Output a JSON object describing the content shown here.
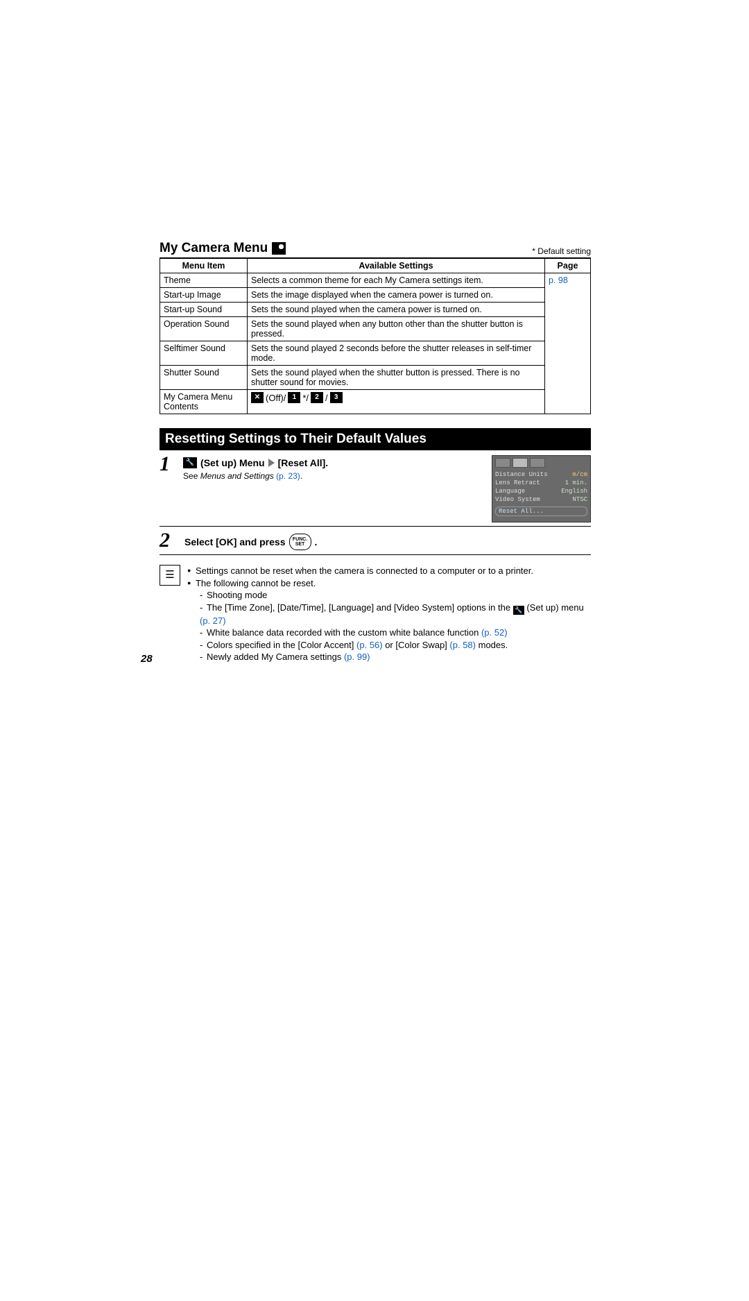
{
  "page_number": "28",
  "title": "My Camera Menu",
  "default_note": "* Default setting",
  "table": {
    "headers": [
      "Menu Item",
      "Available Settings",
      "Page"
    ],
    "page_ref": "p. 98",
    "rows": [
      {
        "item": "Theme",
        "desc": "Selects a common theme for each My Camera settings item."
      },
      {
        "item": "Start-up Image",
        "desc": "Sets the image displayed when the camera power is turned on."
      },
      {
        "item": "Start-up Sound",
        "desc": "Sets the sound played when the camera power is turned on."
      },
      {
        "item": "Operation Sound",
        "desc": "Sets the sound played when any button other than the shutter button is pressed."
      },
      {
        "item": "Selftimer Sound",
        "desc": "Sets the sound played 2 seconds before the shutter releases in self-timer mode."
      },
      {
        "item": "Shutter Sound",
        "desc": "Sets the sound played when the shutter button is pressed. There is no shutter sound for movies."
      },
      {
        "item": "My Camera Menu Contents",
        "desc_icons": {
          "off": "(Off)/",
          "sep": "/",
          "star": "*/"
        }
      }
    ]
  },
  "banner": "Resetting Settings to Their Default Values",
  "steps": {
    "s1": {
      "num": "1",
      "label_pre": "(Set up) Menu",
      "label_post": "[Reset All].",
      "see_text": "See ",
      "see_em": "Menus and Settings ",
      "see_link": "(p. 23)",
      "lcd": {
        "rows": [
          {
            "l": "Distance Units",
            "r": "m/cm"
          },
          {
            "l": "Lens Retract",
            "r": "1 min."
          },
          {
            "l": "Language",
            "r": "English"
          },
          {
            "l": "Video System",
            "r": "NTSC"
          }
        ],
        "reset": "Reset All..."
      }
    },
    "s2": {
      "num": "2",
      "label": "Select [OK] and press ",
      "func_top": "FUNC.",
      "func_bot": "SET",
      "period": "."
    }
  },
  "notes": {
    "b1": "Settings cannot be reset when the camera is connected to a computer or to a printer.",
    "b2": "The following cannot be reset.",
    "sub": {
      "a": "Shooting mode",
      "b_pre": "The [Time Zone], [Date/Time], [Language] and [Video System] options in the ",
      "b_mid": " (Set up) menu ",
      "b_link": "(p. 27)",
      "c_pre": "White balance data recorded with the custom white balance function ",
      "c_link": "(p. 52)",
      "d_pre": "Colors specified in the [Color Accent] ",
      "d_link1": "(p. 56)",
      "d_mid": " or [Color Swap] ",
      "d_link2": "(p. 58)",
      "d_post": " modes.",
      "e_pre": "Newly added My Camera settings ",
      "e_link": "(p. 99)"
    }
  }
}
